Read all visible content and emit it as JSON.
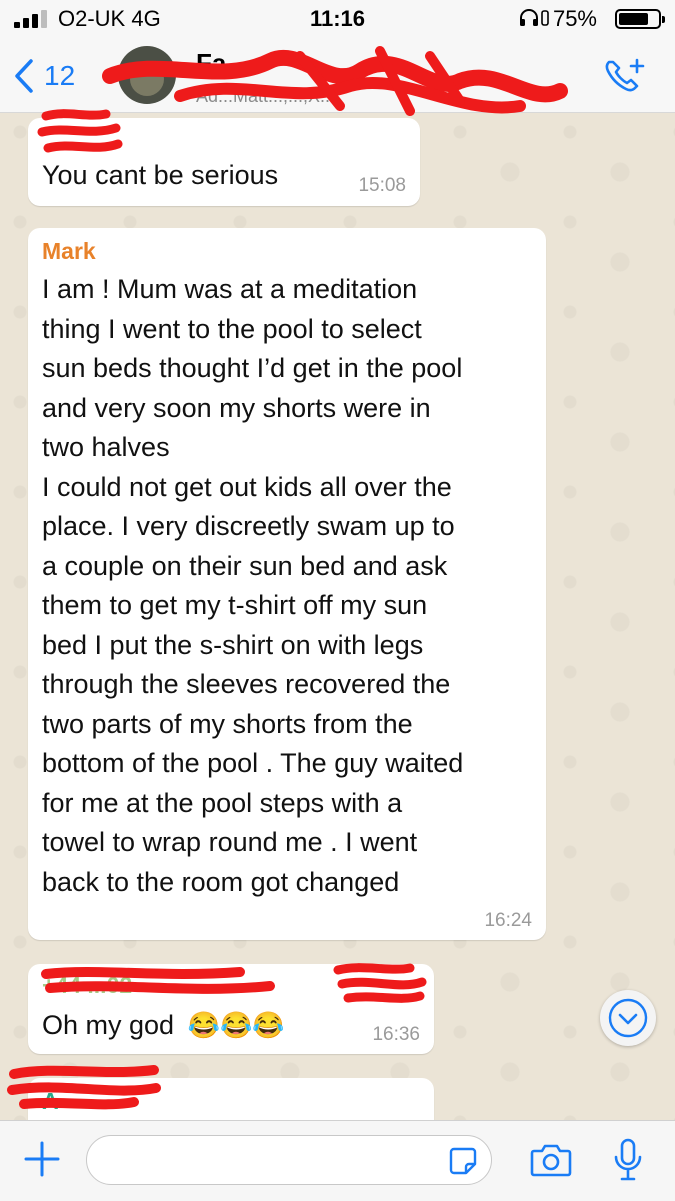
{
  "status_bar": {
    "carrier": "O2-UK  4G",
    "time": "11:16",
    "battery_text": "75%",
    "battery_level": 0.75,
    "signal_bars": 3
  },
  "header": {
    "back_count": "12",
    "title": "Fa",
    "subtitle": "Ad...Matt...,...,X...",
    "icons": {
      "back": "chevron-left-icon",
      "call": "add-call-icon"
    },
    "accent_color": "#1a7cf5"
  },
  "messages": [
    {
      "sender": "",
      "sender_color": "#2aa889",
      "text": "You cant be serious",
      "time": "15:08"
    },
    {
      "sender": "Mark",
      "sender_color": "#e8822a",
      "lines": [
        "I am ! Mum was at a meditation",
        "thing I went to the pool to select",
        "sun beds thought I’d get in the pool",
        "and very soon my shorts were in",
        "two halves",
        "I could not get out kids all over the",
        "place. I very discreetly swam up to",
        "a couple on their sun bed and ask",
        "them to get my t-shirt off my sun",
        "bed I put the s-shirt on with legs",
        "through the sleeves recovered the",
        "two parts of my shorts from the",
        "bottom of the pool . The guy waited",
        "for me at the pool steps with a",
        "towel to wrap round me . I went",
        "back to the room got changed"
      ],
      "time": "16:24"
    },
    {
      "sender": "+44 ...02",
      "sender_color": "#6aab3c",
      "text": "Oh my god",
      "emojis": "😂😂😂",
      "time": "16:36"
    },
    {
      "sender": "A",
      "sender_color": "#2aa889",
      "text": ""
    }
  ],
  "scroll_button": {
    "icon": "chevron-down-circle-icon"
  },
  "input_bar": {
    "placeholder": "",
    "icons": [
      "plus-icon",
      "sticker-icon",
      "camera-icon",
      "microphone-icon"
    ]
  },
  "colors": {
    "redaction": "#ee1b1b",
    "bubble": "#ffffff",
    "wallpaper": "#ebe4d6"
  }
}
